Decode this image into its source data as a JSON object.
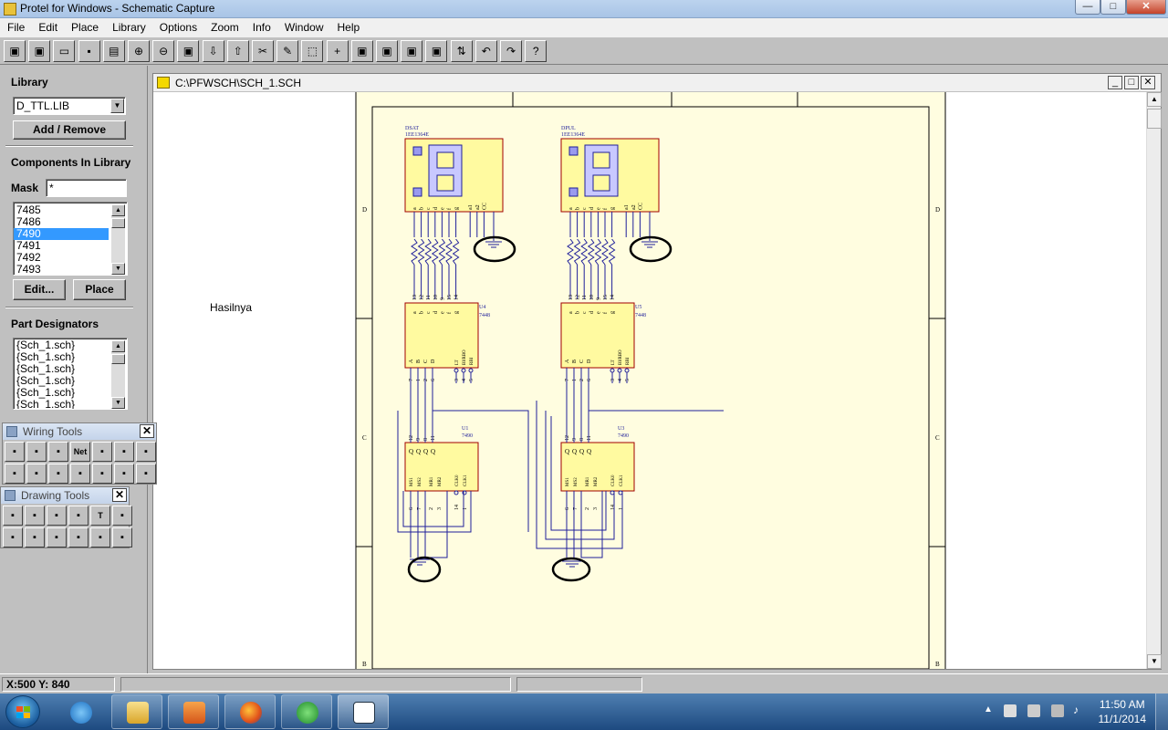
{
  "app": {
    "title": "Protel for Windows - Schematic Capture"
  },
  "window_controls": {
    "minimize": "—",
    "maximize": "□",
    "close": "✕"
  },
  "menubar": {
    "items": [
      "File",
      "Edit",
      "Place",
      "Library",
      "Options",
      "Zoom",
      "Info",
      "Window",
      "Help"
    ]
  },
  "toolbar": {
    "buttons": [
      {
        "icon": "database-icon"
      },
      {
        "icon": "project-icon"
      },
      {
        "icon": "open-folder-icon"
      },
      {
        "icon": "save-icon"
      },
      {
        "icon": "print-icon"
      },
      {
        "icon": "zoom-in-icon"
      },
      {
        "icon": "zoom-out-icon"
      },
      {
        "icon": "zoom-fit-icon"
      },
      {
        "icon": "arrow-down-icon"
      },
      {
        "icon": "arrow-up-icon"
      },
      {
        "icon": "cut-wire-icon"
      },
      {
        "icon": "pencil-icon"
      },
      {
        "icon": "select-box-icon"
      },
      {
        "icon": "move-cross-icon"
      },
      {
        "icon": "bus-icon"
      },
      {
        "icon": "component-icon"
      },
      {
        "icon": "library-book-icon"
      },
      {
        "icon": "library-edit-icon"
      },
      {
        "icon": "netlist-icon"
      },
      {
        "icon": "undo-icon"
      },
      {
        "icon": "redo-icon"
      },
      {
        "icon": "help-icon",
        "label": "?"
      }
    ]
  },
  "library_panel": {
    "library_heading": "Library",
    "library_selected": "D_TTL.LIB",
    "add_remove_label": "Add / Remove",
    "components_heading": "Components In Library",
    "mask_label": "Mask",
    "mask_value": "*",
    "components": [
      "7485",
      "7486",
      "7490",
      "7491",
      "7492",
      "7493"
    ],
    "selected_component": "7490",
    "edit_label": "Edit...",
    "place_label": "Place",
    "designators_heading": "Part Designators",
    "designators": [
      "{Sch_1.sch}",
      "{Sch_1.sch}",
      "{Sch_1.sch}",
      "{Sch_1.sch}",
      "{Sch_1.sch}",
      "{Sch_1.sch}"
    ]
  },
  "wiring_tools": {
    "title": "Wiring Tools",
    "close": "✕",
    "row1": [
      "bus-entry-icon",
      "wire-icon",
      "bus-icon",
      "Net",
      "power-port-icon",
      "part-icon",
      "sheet-icon"
    ],
    "row2": [
      "sheet-entry-icon",
      "port-icon",
      "junction-icon",
      "pencil-icon",
      "bus-lines-icon",
      "no-erc-icon",
      "directive-icon"
    ]
  },
  "drawing_tools": {
    "title": "Drawing Tools",
    "close": "✕",
    "row1": [
      "line-icon",
      "polygon-icon",
      "arc-icon",
      "bezier-icon",
      "T",
      "text-frame-icon"
    ],
    "row2": [
      "rectangle-icon",
      "rounded-rect-icon",
      "ellipse-icon",
      "pie-icon",
      "graphic-icon",
      "array-icon"
    ]
  },
  "document": {
    "title": "C:\\PFWSCH\\SCH_1.SCH",
    "annotation": "Hasilnya",
    "border_zones": {
      "d": "D",
      "c": "C",
      "b": "B"
    },
    "displays": [
      {
        "name": "DSAT",
        "part": "1EE1364E",
        "pins": [
          "a",
          "b",
          "c",
          "d",
          "e",
          "f",
          "g",
          "a1",
          "a2",
          "CC"
        ]
      },
      {
        "name": "DPUL",
        "part": "1EE1364E",
        "pins": [
          "a",
          "b",
          "c",
          "d",
          "e",
          "f",
          "g",
          "a1",
          "a2",
          "CC"
        ]
      }
    ],
    "decoders": [
      {
        "ref": "U4",
        "part": "7448",
        "outs": [
          "a",
          "b",
          "c",
          "d",
          "e",
          "f",
          "g"
        ],
        "out_nums": [
          "13",
          "12",
          "11",
          "10",
          "9",
          "15",
          "14"
        ],
        "ins": [
          "A",
          "B",
          "C",
          "D"
        ],
        "ctrl": [
          "LT",
          "BI/RBO",
          "RBI"
        ]
      },
      {
        "ref": "U5",
        "part": "7448",
        "outs": [
          "a",
          "b",
          "c",
          "d",
          "e",
          "f",
          "g"
        ],
        "out_nums": [
          "13",
          "12",
          "11",
          "10",
          "9",
          "15",
          "14"
        ],
        "ins": [
          "A",
          "B",
          "C",
          "D"
        ],
        "ctrl": [
          "LT",
          "BI/RBO",
          "RBI"
        ]
      }
    ],
    "counters": [
      {
        "ref": "U1",
        "part": "7490",
        "top_nums": [
          "12",
          "9",
          "8",
          "11"
        ],
        "bottom": [
          "MS1",
          "MS2",
          "MR1",
          "MR2",
          "CLK0",
          "CLK1"
        ],
        "bottom_nums": [
          "6",
          "7",
          "2",
          "3",
          "14",
          "1"
        ]
      },
      {
        "ref": "U3",
        "part": "7490",
        "top_nums": [
          "12",
          "9",
          "8",
          "11"
        ],
        "bottom": [
          "MS1",
          "MS2",
          "MR1",
          "MR2",
          "CLK0",
          "CLK1"
        ],
        "bottom_nums": [
          "6",
          "7",
          "2",
          "3",
          "14",
          "1"
        ]
      }
    ],
    "decoder_in_nums": [
      "7",
      "1",
      "2",
      "6"
    ],
    "decoder_ctrl_nums": [
      "3",
      "4",
      "5"
    ]
  },
  "statusbar": {
    "coords": "X:500 Y: 840"
  },
  "taskbar": {
    "items": [
      "internet-explorer-icon",
      "file-explorer-icon",
      "media-player-icon",
      "firefox-icon",
      "app-green-icon",
      "protel-app-icon"
    ],
    "time": "11:50 AM",
    "date": "11/1/2014"
  }
}
